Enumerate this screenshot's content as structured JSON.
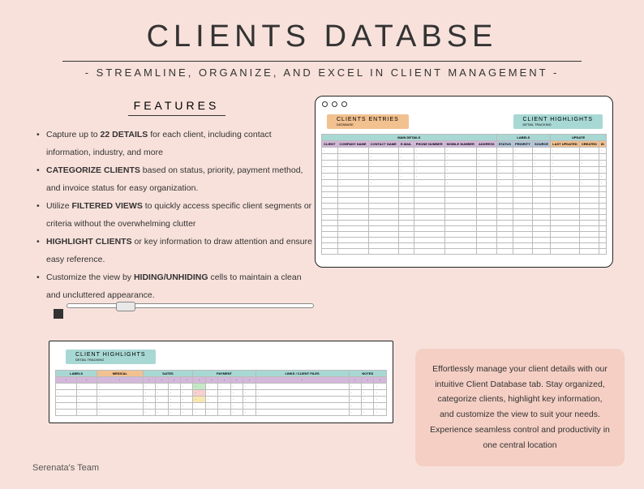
{
  "title": "CLIENTS DATABSE",
  "subtitle": "- STREAMLINE, ORGANIZE, AND EXCEL IN CLIENT MANAGEMENT -",
  "features": {
    "heading": "FEATURES",
    "items": [
      {
        "pre": "Capture up to ",
        "bold": "22 DETAILS",
        "post": " for each client, including contact information, industry, and more"
      },
      {
        "pre": "",
        "bold": "CATEGORIZE CLIENTS",
        "post": " based on status, priority, payment method, and invoice status for easy organization."
      },
      {
        "pre": "Utilize ",
        "bold": "FILTERED VIEWS",
        "post": " to quickly access specific client segments or criteria without the overwhelming clutter"
      },
      {
        "pre": "",
        "bold": "HIGHLIGHT CLIENTS",
        "post": " or key information to draw attention and ensure easy reference."
      },
      {
        "pre": "Customize the view by ",
        "bold": "HIDING/UNHIDING",
        "post": " cells to maintain a clean and uncluttered appearance."
      }
    ]
  },
  "win_main": {
    "badge1": "CLIENTS ENTRIES",
    "badge1_sub": "DATABASE",
    "badge2": "CLIENT HIGHLIGHTS",
    "badge2_sub": "DETAIL TRACKING",
    "section1": "MAIN DETAILS",
    "section2": "LABELS",
    "section3": "UPDATE",
    "headers1": [
      "CLIENT",
      "COMPANY NAME",
      "CONTACT NAME",
      "E-MAIL",
      "PHONE NUMBER",
      "MOBILE NUMBER",
      "ADDRESS"
    ],
    "headers2": [
      "STATUS",
      "PRIORITY",
      "SOURCE"
    ],
    "headers3": [
      "LAST UPDATED",
      "CREATED",
      "ID"
    ]
  },
  "win_bottom": {
    "badge": "CLIENT HIGHLIGHTS",
    "badge_sub": "DETAIL TRACKING",
    "sections": [
      "LABELS",
      "MEDICAL",
      "DATES",
      "PAYMENT",
      "LINKS / CLIENT FILES",
      "NOTES"
    ]
  },
  "promo": "Effortlessly manage your client details with our intuitive Client Database tab. Stay organized, categorize clients, highlight key information, and customize the view to suit your needs. Experience seamless control and productivity in one central location",
  "footer": "Serenata's Team"
}
